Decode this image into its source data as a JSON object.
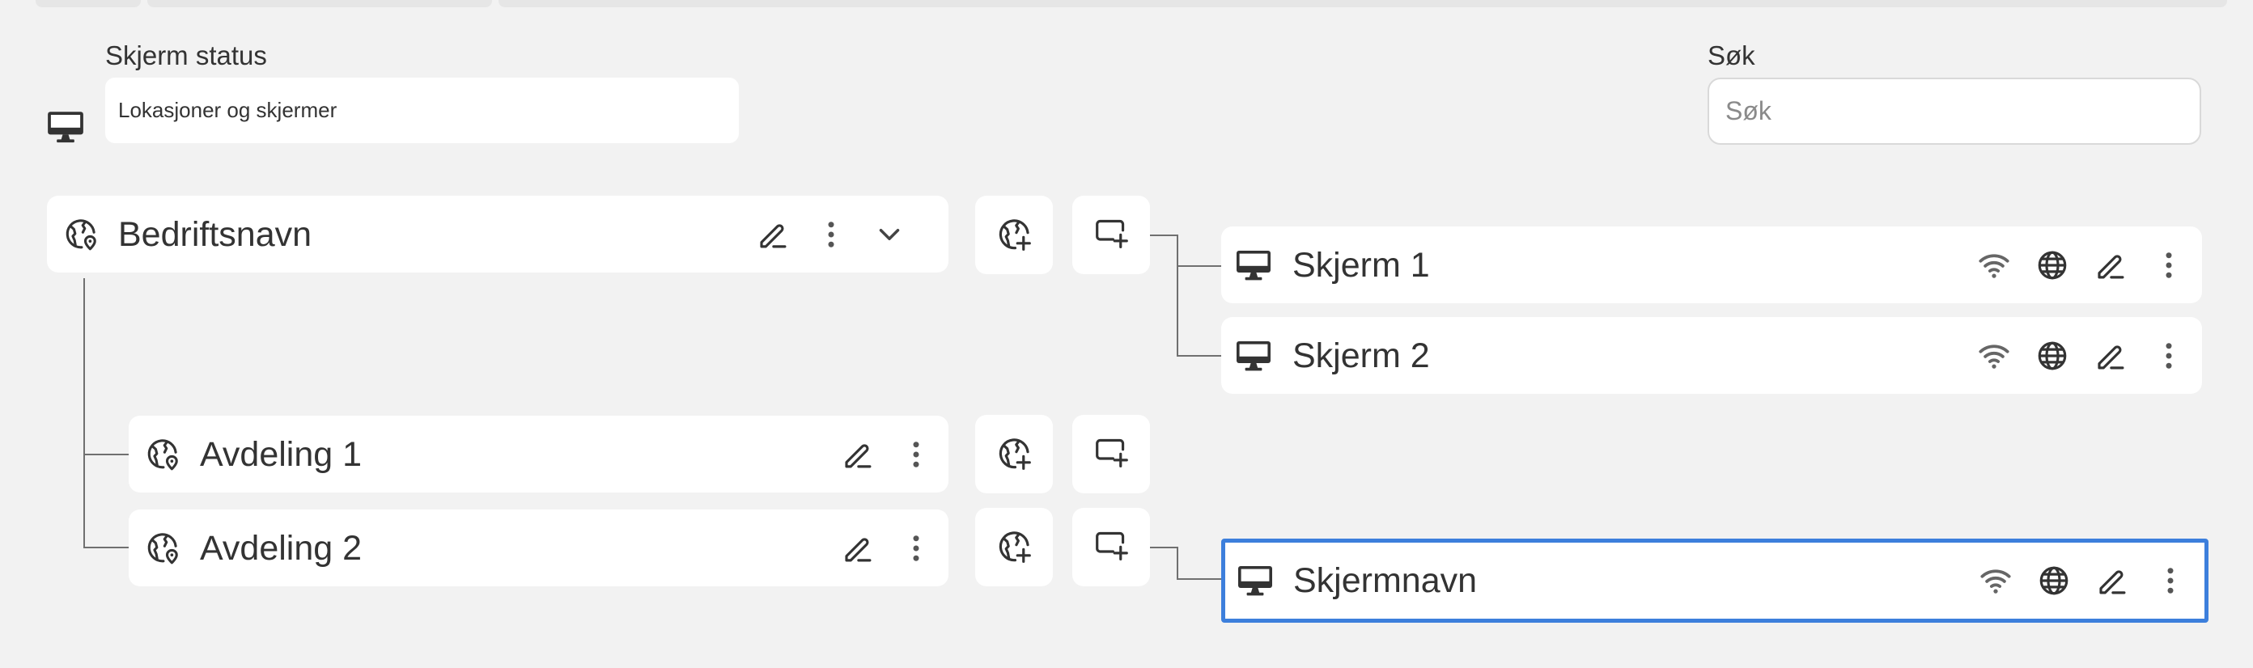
{
  "filter": {
    "status_label": "Skjerm status",
    "status_value": "Lokasjoner og skjermer",
    "search_label": "Søk",
    "search_placeholder": "Søk"
  },
  "tree": {
    "company": {
      "name": "Bedriftsnavn"
    },
    "departments": [
      {
        "name": "Avdeling 1"
      },
      {
        "name": "Avdeling 2"
      }
    ],
    "screens": [
      {
        "name": "Skjerm 1",
        "parent": "Bedriftsnavn"
      },
      {
        "name": "Skjerm 2",
        "parent": "Bedriftsnavn"
      },
      {
        "name": "Skjermnavn",
        "parent": "Avdeling 2",
        "selected": true
      }
    ]
  },
  "colors": {
    "background": "#f2f2f2",
    "card": "#ffffff",
    "selection": "#3d7fdc",
    "text": "#333333"
  }
}
